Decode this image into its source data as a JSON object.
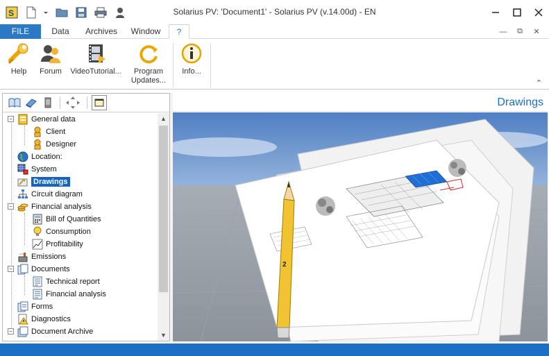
{
  "window": {
    "title": "Solarius PV: 'Document1' - Solarius PV (v.14.00d) - EN"
  },
  "quick_access": [
    "app-icon",
    "new-document-icon",
    "open-folder-icon",
    "save-icon",
    "print-icon",
    "user-icon"
  ],
  "tabs": [
    {
      "label": "FILE"
    },
    {
      "label": "Data"
    },
    {
      "label": "Archives"
    },
    {
      "label": "Window"
    },
    {
      "label": "?"
    }
  ],
  "ribbon": {
    "buttons": [
      {
        "label": "Help",
        "icon": "wrench-help-icon"
      },
      {
        "label": "Forum",
        "icon": "users-forum-icon"
      },
      {
        "label": "VideoTutorial...",
        "icon": "film-icon"
      },
      {
        "label": "Program Updates...",
        "icon": "refresh-icon"
      },
      {
        "label": "Info...",
        "icon": "info-icon"
      }
    ],
    "updates_line1": "Program",
    "updates_line2": "Updates..."
  },
  "tree": {
    "toolbar_icons": [
      "open-book-icon",
      "book-icon",
      "mobile-icon",
      "move-icon",
      "window-icon"
    ],
    "items": [
      {
        "label": "General data",
        "icon": "folder-data-icon"
      },
      {
        "label": "Client",
        "icon": "person-icon"
      },
      {
        "label": "Designer",
        "icon": "person-icon"
      },
      {
        "label": "Location:",
        "icon": "globe-icon"
      },
      {
        "label": "System",
        "icon": "solar-grid-icon"
      },
      {
        "label": "Drawings",
        "icon": "drawings-icon"
      },
      {
        "label": "Circuit diagram",
        "icon": "circuit-icon"
      },
      {
        "label": "Financial analysis",
        "icon": "coins-icon"
      },
      {
        "label": "Bill of Quantities",
        "icon": "calculator-icon"
      },
      {
        "label": "Consumption",
        "icon": "bulb-icon"
      },
      {
        "label": "Profitability",
        "icon": "chart-icon"
      },
      {
        "label": "Emissions",
        "icon": "factory-icon"
      },
      {
        "label": "Documents",
        "icon": "documents-icon"
      },
      {
        "label": "Technical report",
        "icon": "report-icon"
      },
      {
        "label": "Financial analysis",
        "icon": "report-icon"
      },
      {
        "label": "Forms",
        "icon": "forms-icon"
      },
      {
        "label": "Diagnostics",
        "icon": "warning-icon"
      },
      {
        "label": "Document Archive",
        "icon": "archive-icon"
      }
    ]
  },
  "panel": {
    "title": "Drawings"
  },
  "colors": {
    "accent": "#2b78c5",
    "status_bar": "#1a70c5",
    "selection": "#1565c0",
    "panel_title": "#1a6fc4"
  }
}
